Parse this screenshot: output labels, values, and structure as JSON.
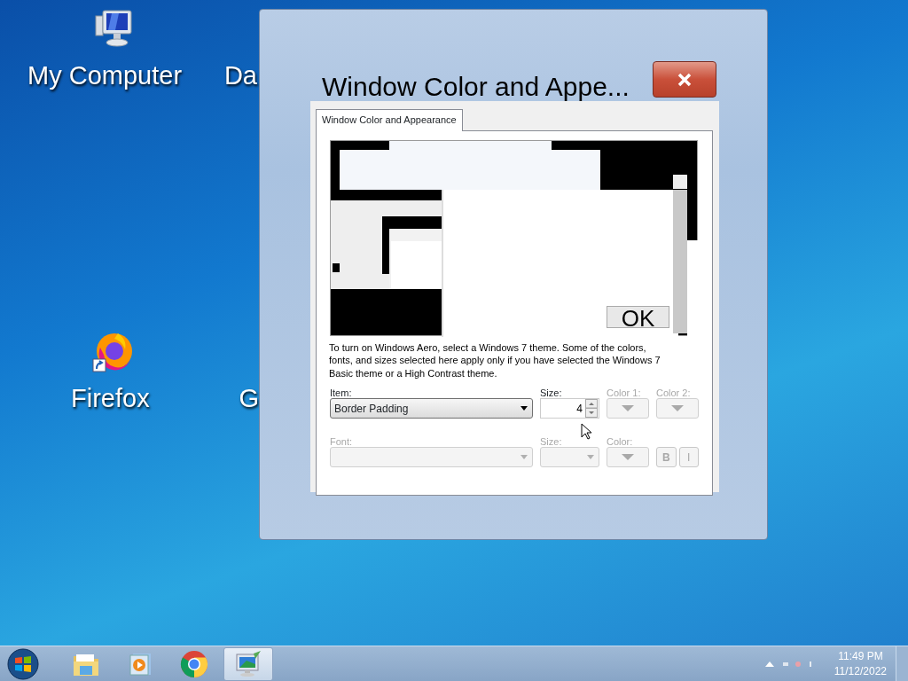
{
  "desktop": {
    "icons": [
      {
        "label": "My Computer",
        "kind": "computer"
      },
      {
        "label": "Da",
        "kind": "hidden"
      },
      {
        "label": "Firefox",
        "kind": "firefox"
      },
      {
        "label": "G",
        "kind": "hidden"
      }
    ]
  },
  "window": {
    "title": "Window Color and Appe...",
    "tabs": [
      {
        "label": "Window Color and Appearance",
        "selected": true
      }
    ],
    "preview": {
      "button": "OK"
    },
    "description": "To turn on Windows Aero, select a Windows 7 theme.  Some of the colors, fonts, and sizes selected here apply only if you have selected the Windows 7 Basic theme or a High Contrast theme.",
    "controls": [
      {
        "kind": "combo",
        "label": "Item:",
        "value": "Border Padding",
        "disabled": false
      },
      {
        "kind": "spin",
        "label": "Size:",
        "value": "4",
        "disabled": false
      },
      {
        "kind": "color",
        "label": "Color 1:",
        "disabled": true
      },
      {
        "kind": "color",
        "label": "Color 2:",
        "disabled": true
      },
      {
        "kind": "combo",
        "label": "Font:",
        "disabled": true
      },
      {
        "kind": "combo-small",
        "label": "Size:",
        "disabled": true
      },
      {
        "kind": "color",
        "label": "Color:",
        "disabled": true
      },
      {
        "kind": "styles",
        "buttons": [
          "B",
          "I"
        ],
        "disabled": true
      }
    ]
  },
  "taskbar": {
    "buttons": [
      {
        "kind": "start",
        "active": false
      },
      {
        "kind": "folder",
        "active": false
      },
      {
        "kind": "media",
        "active": false
      },
      {
        "kind": "chrome",
        "active": false
      },
      {
        "kind": "display",
        "active": true
      }
    ],
    "clock": {
      "time": "11:49 PM",
      "date": "11/12/2022"
    }
  }
}
